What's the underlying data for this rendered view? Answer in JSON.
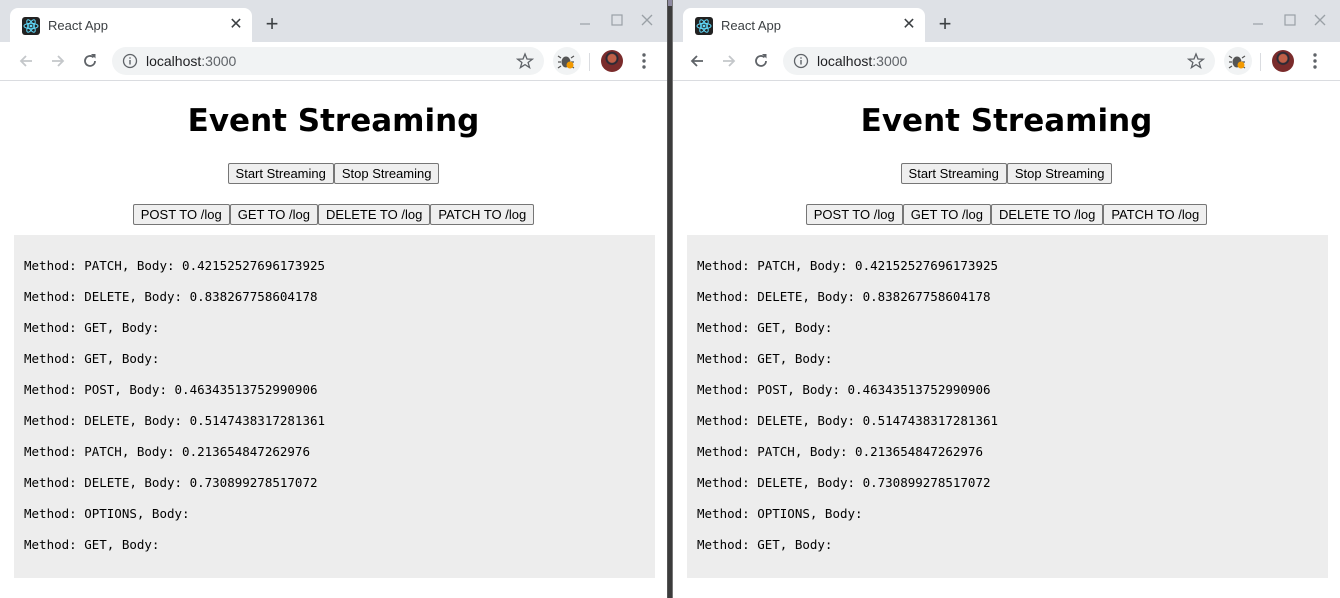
{
  "browser": {
    "tab_title": "React App",
    "url_host": "localhost",
    "url_port": ":3000",
    "icons": {
      "favicon": "react-logo-icon",
      "close": "close-icon",
      "new_tab": "plus-icon",
      "back": "arrow-left-icon",
      "forward": "arrow-right-icon",
      "reload": "reload-icon",
      "info": "info-icon",
      "bookmark": "star-icon",
      "extension": "bug-extension-icon",
      "menu": "kebab-menu-icon"
    }
  },
  "page": {
    "title": "Event Streaming",
    "stream_buttons": [
      "Start Streaming",
      "Stop Streaming"
    ],
    "method_buttons": [
      "POST TO /log",
      "GET TO /log",
      "DELETE TO /log",
      "PATCH TO /log"
    ],
    "log": [
      "Method: PATCH, Body: 0.42152527696173925",
      "Method: DELETE, Body: 0.838267758604178",
      "Method: GET, Body:",
      "Method: GET, Body:",
      "Method: POST, Body: 0.46343513752990906",
      "Method: DELETE, Body: 0.5147438317281361",
      "Method: PATCH, Body: 0.213654847262976",
      "Method: DELETE, Body: 0.730899278517072",
      "Method: OPTIONS, Body:",
      "Method: GET, Body:"
    ]
  },
  "colors": {
    "tabbar_bg": "#dee1e6",
    "log_bg": "#ededed",
    "react_blue": "#61dafb"
  }
}
